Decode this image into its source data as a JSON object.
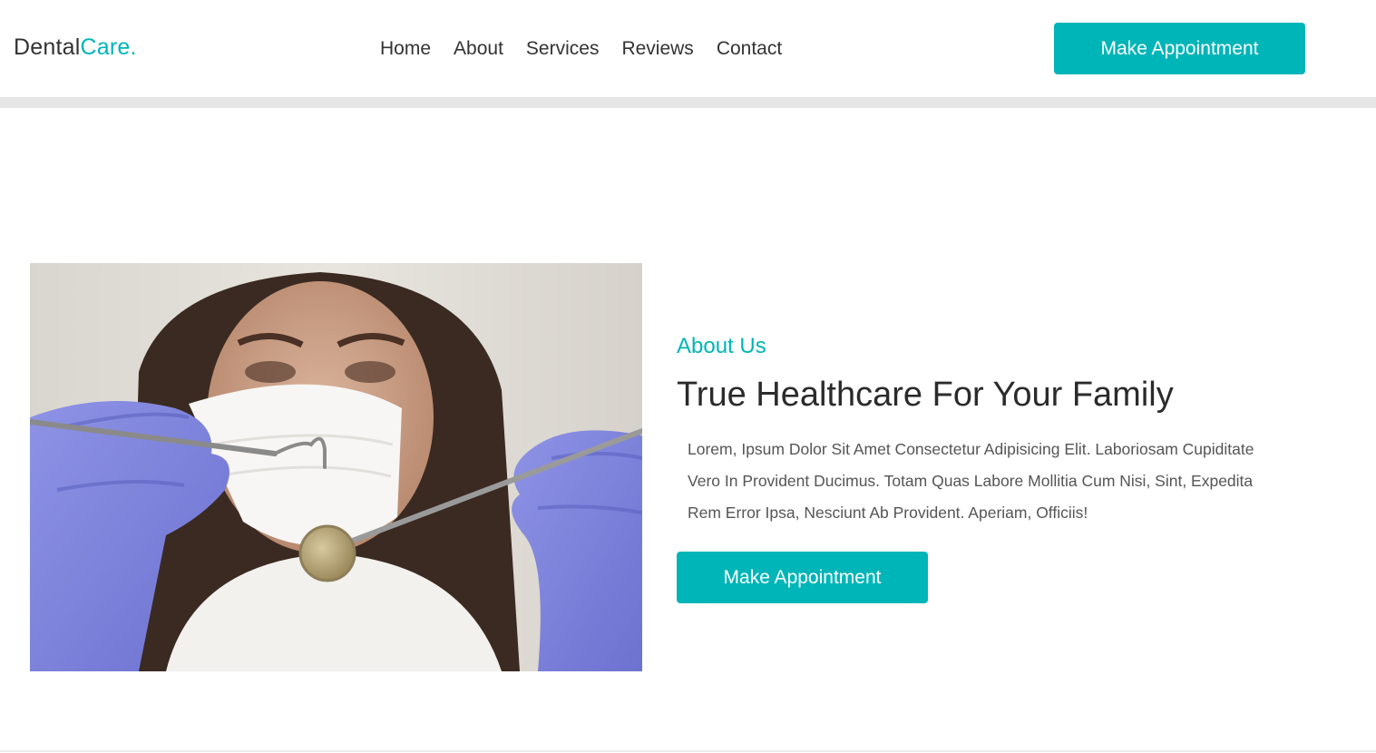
{
  "brand": {
    "name_part1": "Dental",
    "name_part2": "Care.",
    "accent_color": "#00b5b8"
  },
  "nav": {
    "items": [
      {
        "label": "Home"
      },
      {
        "label": "About"
      },
      {
        "label": "Services"
      },
      {
        "label": "Reviews"
      },
      {
        "label": "Contact"
      }
    ]
  },
  "header": {
    "cta_label": "Make Appointment"
  },
  "about": {
    "image_icon": "dentist-photo",
    "subtitle": "About Us",
    "title": "True Healthcare For Your Family",
    "text": "Lorem, Ipsum Dolor Sit Amet Consectetur Adipisicing Elit. Laboriosam Cupiditate Vero In Provident Ducimus. Totam Quas Labore Mollitia Cum Nisi, Sint, Expedita Rem Error Ipsa, Nesciunt Ab Provident. Aperiam, Officiis!",
    "cta_label": "Make Appointment"
  }
}
